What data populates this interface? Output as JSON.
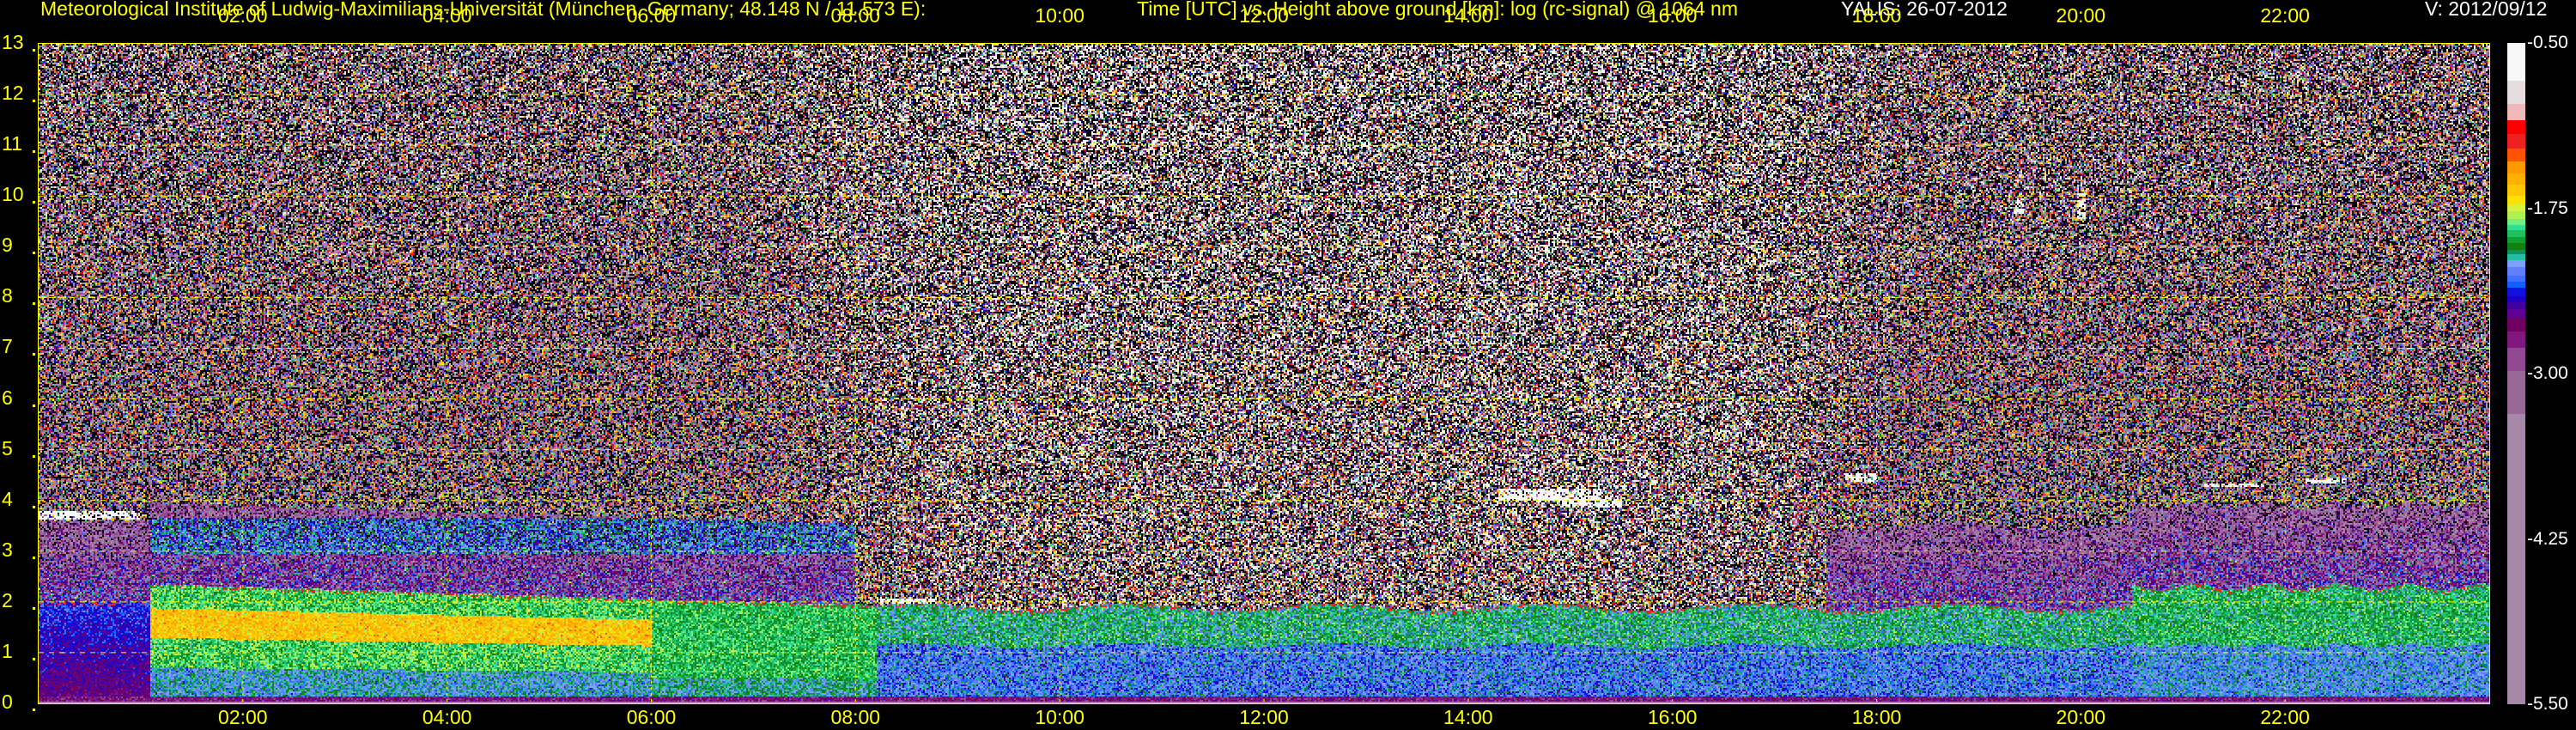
{
  "header": {
    "institute": "Meteorological Institute of Ludwig-Maximilians-Universität (München, Germany; 48.148 N / 11.573 E):",
    "description": "Time [UTC] vs. Height above ground [km]: log (rc-signal) @ 1064 nm",
    "instrument_date": "YALIS: 26-07-2012",
    "version": "V: 2012/09/12"
  },
  "chart_data": {
    "type": "heatmap",
    "title": "Time [UTC] vs. Height above ground [km]: log (rc-signal) @ 1064 nm",
    "xlabel": "Time [UTC]",
    "ylabel": "Height above ground [km]",
    "xlim": [
      0,
      24
    ],
    "ylim": [
      0,
      13
    ],
    "x_ticks": [
      {
        "value": 2,
        "label": "02:00"
      },
      {
        "value": 4,
        "label": "04:00"
      },
      {
        "value": 6,
        "label": "06:00"
      },
      {
        "value": 8,
        "label": "08:00"
      },
      {
        "value": 10,
        "label": "10:00"
      },
      {
        "value": 12,
        "label": "12:00"
      },
      {
        "value": 14,
        "label": "14:00"
      },
      {
        "value": 16,
        "label": "16:00"
      },
      {
        "value": 18,
        "label": "18:00"
      },
      {
        "value": 20,
        "label": "20:00"
      },
      {
        "value": 22,
        "label": "22:00"
      }
    ],
    "y_ticks": [
      {
        "value": 0,
        "label": "0"
      },
      {
        "value": 1,
        "label": "1"
      },
      {
        "value": 2,
        "label": "2"
      },
      {
        "value": 3,
        "label": "3"
      },
      {
        "value": 4,
        "label": "4"
      },
      {
        "value": 5,
        "label": "5"
      },
      {
        "value": 6,
        "label": "6"
      },
      {
        "value": 7,
        "label": "7"
      },
      {
        "value": 8,
        "label": "8"
      },
      {
        "value": 9,
        "label": "9"
      },
      {
        "value": 10,
        "label": "10"
      },
      {
        "value": 11,
        "label": "11"
      },
      {
        "value": 12,
        "label": "12"
      },
      {
        "value": 13,
        "label": "13"
      }
    ],
    "grid": true,
    "colorbar": {
      "range": [
        -5.5,
        -0.5
      ],
      "ticks": [
        {
          "value": -0.5,
          "label": "-0.50"
        },
        {
          "value": -1.75,
          "label": "-1.75"
        },
        {
          "value": -3.0,
          "label": "-3.00"
        },
        {
          "value": -4.25,
          "label": "-4.25"
        },
        {
          "value": -5.5,
          "label": "-5.50"
        }
      ],
      "segments": [
        {
          "lower": -0.785,
          "color": "#f8f8f8"
        },
        {
          "lower": -0.96,
          "color": "#e6dede"
        },
        {
          "lower": -1.087,
          "color": "#f0b8b8"
        },
        {
          "lower": -1.188,
          "color": "#ff0000"
        },
        {
          "lower": -1.299,
          "color": "#ee2020"
        },
        {
          "lower": -1.399,
          "color": "#ff5500"
        },
        {
          "lower": -1.49,
          "color": "#ff9900"
        },
        {
          "lower": -1.574,
          "color": "#ffb000"
        },
        {
          "lower": -1.658,
          "color": "#ffc800"
        },
        {
          "lower": -1.718,
          "color": "#ffe000"
        },
        {
          "lower": -1.775,
          "color": "#d8f040"
        },
        {
          "lower": -1.832,
          "color": "#b0f050"
        },
        {
          "lower": -1.876,
          "color": "#70f080"
        },
        {
          "lower": -1.916,
          "color": "#30e090"
        },
        {
          "lower": -1.966,
          "color": "#20c060"
        },
        {
          "lower": -2.01,
          "color": "#10a030"
        },
        {
          "lower": -2.067,
          "color": "#108010"
        },
        {
          "lower": -2.1,
          "color": "#109060"
        },
        {
          "lower": -2.144,
          "color": "#20c0a0"
        },
        {
          "lower": -2.195,
          "color": "#80a0ff"
        },
        {
          "lower": -2.262,
          "color": "#6080ff"
        },
        {
          "lower": -2.302,
          "color": "#4070ff"
        },
        {
          "lower": -2.352,
          "color": "#1060ff"
        },
        {
          "lower": -2.413,
          "color": "#1010e0"
        },
        {
          "lower": -2.463,
          "color": "#2000c0"
        },
        {
          "lower": -2.513,
          "color": "#4000a0"
        },
        {
          "lower": -2.58,
          "color": "#600090"
        },
        {
          "lower": -2.681,
          "color": "#700060"
        },
        {
          "lower": -2.805,
          "color": "#801880"
        },
        {
          "lower": -2.983,
          "color": "#904890"
        },
        {
          "lower": -3.302,
          "color": "#986898"
        },
        {
          "lower": -5.5,
          "color": "#a888a8"
        }
      ]
    }
  },
  "colors": {
    "axis": "#ffff00",
    "grid": "#ffff00",
    "background": "#000000"
  }
}
